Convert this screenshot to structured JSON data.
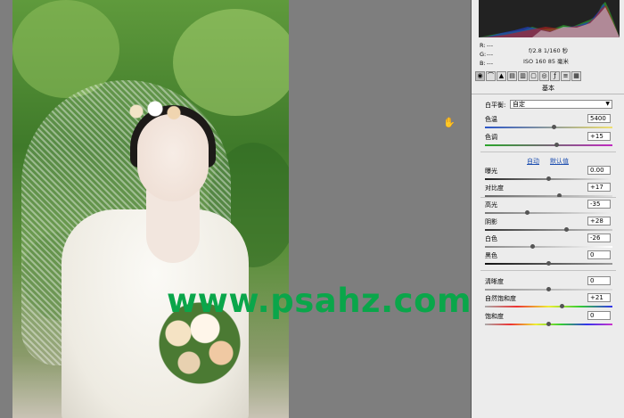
{
  "watermark": "www.psahz.com",
  "readouts": {
    "r_label": "R:",
    "r_value": "---",
    "g_label": "G:",
    "g_value": "---",
    "b_label": "B:",
    "b_value": "---",
    "aperture_shutter": "f/2.8   1/160 秒",
    "iso_focal": "ISO 160   85 毫米"
  },
  "panel": {
    "title": "基本",
    "white_balance_label": "白平衡:",
    "white_balance_value": "自定",
    "temperature_label": "色温",
    "temperature_value": "5400",
    "tint_label": "色调",
    "tint_value": "+15",
    "auto_label": "自动",
    "default_label": "默认值",
    "exposure_label": "曝光",
    "exposure_value": "0.00",
    "contrast_label": "对比度",
    "contrast_value": "+17",
    "highlights_label": "高光",
    "highlights_value": "-35",
    "shadows_label": "阴影",
    "shadows_value": "+28",
    "whites_label": "白色",
    "whites_value": "-26",
    "blacks_label": "黑色",
    "blacks_value": "0",
    "clarity_label": "清晰度",
    "clarity_value": "0",
    "vibrance_label": "自然饱和度",
    "vibrance_value": "+21",
    "saturation_label": "饱和度",
    "saturation_value": "0"
  },
  "tools": [
    "basic-icon",
    "tone-curve-icon",
    "detail-icon",
    "hsl-icon",
    "split-toning-icon",
    "lens-icon",
    "effects-icon",
    "camera-calibration-icon",
    "presets-icon",
    "snapshots-icon"
  ],
  "colors": {
    "watermark": "#0aa64a",
    "panel_bg": "#ececec",
    "canvas_bg": "#7e7e7e",
    "link": "#1e4fb0"
  }
}
